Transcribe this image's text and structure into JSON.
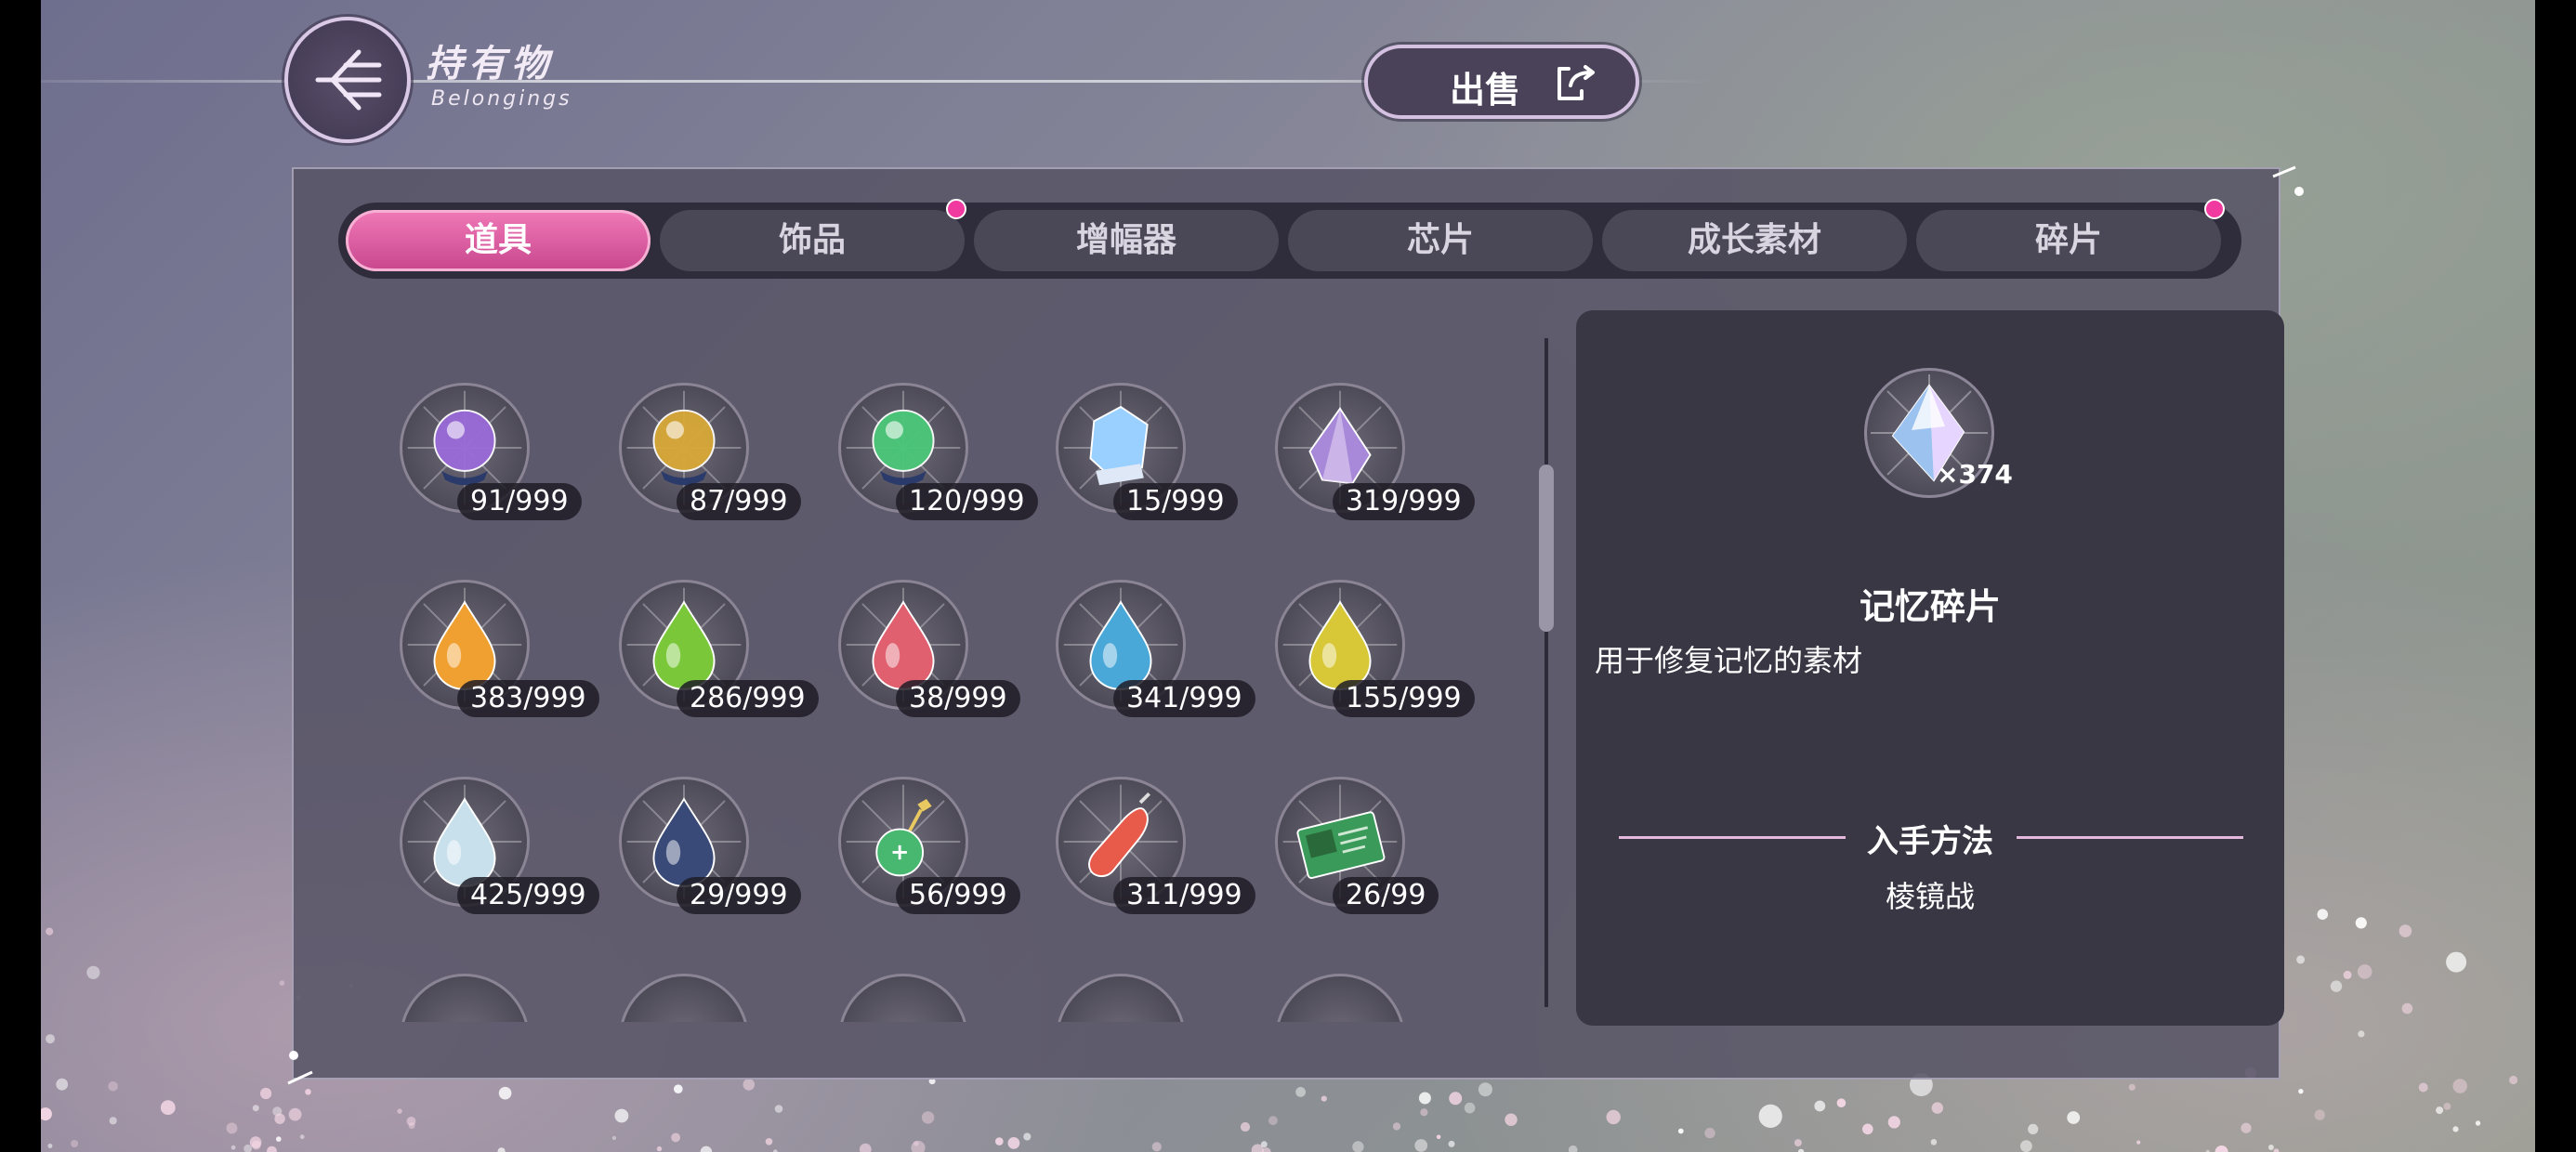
{
  "header": {
    "title": "持有物",
    "subtitle": "Belongings",
    "back_icon": "back-arrow-icon",
    "sell_label": "出售",
    "sell_icon": "export-icon"
  },
  "tabs": [
    {
      "label": "道具",
      "active": true,
      "badge": false
    },
    {
      "label": "饰品",
      "active": false,
      "badge": true
    },
    {
      "label": "增幅器",
      "active": false,
      "badge": false
    },
    {
      "label": "芯片",
      "active": false,
      "badge": false
    },
    {
      "label": "成长素材",
      "active": false,
      "badge": false
    },
    {
      "label": "碎片",
      "active": false,
      "badge": true
    }
  ],
  "items": [
    {
      "icon": "purple-crystal-orb-icon",
      "count": "91/999",
      "color": "#9a6ad8"
    },
    {
      "icon": "gold-crystal-orb-icon",
      "count": "87/999",
      "color": "#d8a838"
    },
    {
      "icon": "green-crystal-orb-icon",
      "count": "120/999",
      "color": "#4ac878"
    },
    {
      "icon": "crystal-cluster-icon",
      "count": "15/999",
      "color": "#9ad0ff"
    },
    {
      "icon": "purple-crystal-icon",
      "count": "319/999",
      "color": "#a888d8"
    },
    {
      "icon": "orange-drop-icon",
      "count": "383/999",
      "color": "#f0a030"
    },
    {
      "icon": "green-drop-icon",
      "count": "286/999",
      "color": "#7ac83a"
    },
    {
      "icon": "red-drop-icon",
      "count": "38/999",
      "color": "#e06070"
    },
    {
      "icon": "blue-drop-icon",
      "count": "341/999",
      "color": "#4aa8d8"
    },
    {
      "icon": "yellow-drop-icon",
      "count": "155/999",
      "color": "#d8c838"
    },
    {
      "icon": "white-drop-icon",
      "count": "425/999",
      "color": "#c8e0ec"
    },
    {
      "icon": "dark-blue-drop-icon",
      "count": "29/999",
      "color": "#3a4a78"
    },
    {
      "icon": "green-pendant-icon",
      "count": "56/999",
      "color": "#48b870"
    },
    {
      "icon": "red-capsule-icon",
      "count": "311/999",
      "color": "#e85a4a"
    },
    {
      "icon": "green-ticket-icon",
      "count": "26/99",
      "color": "#3a9a5a"
    }
  ],
  "detail": {
    "icon": "memory-fragment-crystal-icon",
    "quantity": "×374",
    "name": "记忆碎片",
    "description": "用于修复记忆的素材",
    "acquire_title": "入手方法",
    "acquire_source": "棱镜战"
  },
  "colors": {
    "accent_pink": "#e0609e",
    "badge_pink": "#f03aa0",
    "panel": "#585466"
  }
}
